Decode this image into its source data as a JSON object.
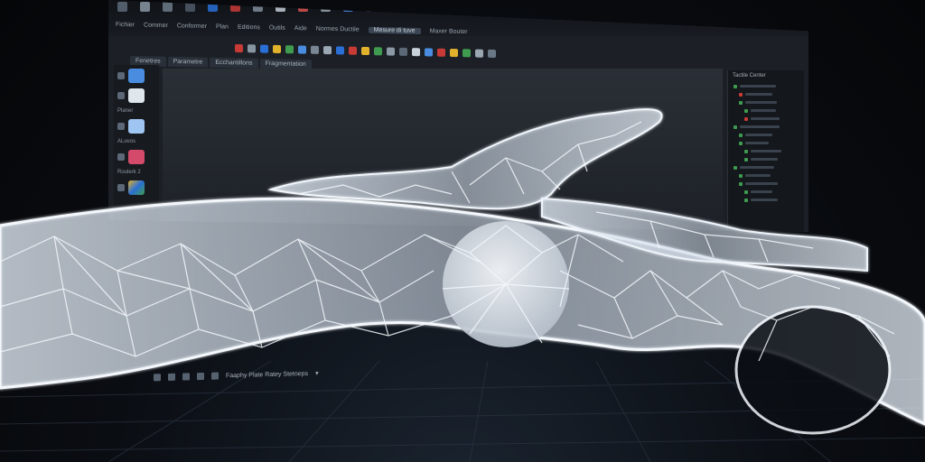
{
  "menu": {
    "items": [
      "Fichier",
      "Commer",
      "Conformer",
      "Plan",
      "Editions",
      "Outils",
      "Aide",
      "Normes Ductile",
      "Mesure di tuve",
      "Maxer Bouter"
    ],
    "active_index": 8
  },
  "doc_tabs": [
    "Fenetres",
    "Parametre",
    "Ecchantillons",
    "Fragmentation"
  ],
  "left_toolbar": {
    "items": [
      {
        "label": "",
        "icon": "extrude-icon"
      },
      {
        "label": "Planer",
        "icon": "box-icon"
      },
      {
        "label": "ALuvos",
        "icon": "cube-icon"
      },
      {
        "label": "Roulerk 2",
        "icon": "shape-icon"
      },
      {
        "label": "",
        "icon": "color-icon"
      }
    ]
  },
  "side_panel": {
    "title": "Tactile Center"
  },
  "status_bar": {
    "text": "Faaphy Plate Ratey Stetoeps"
  },
  "colors": {
    "accent_red": "#c83a36",
    "accent_blue": "#2a6fd6",
    "accent_green": "#3f9b4f",
    "accent_yellow": "#e2b22c",
    "mesh_white": "#eef4fb"
  }
}
